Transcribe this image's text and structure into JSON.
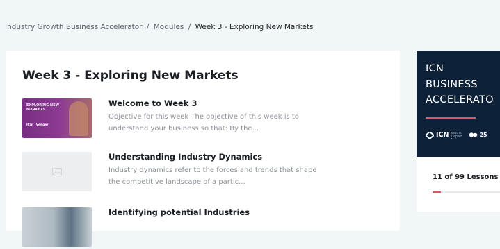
{
  "breadcrumb": {
    "items": [
      "Industry Growth Business Accelerator",
      "Modules"
    ],
    "separator": "/",
    "current": "Week 3 - Exploring New Markets"
  },
  "module": {
    "title": "Week 3 - Exploring New Markets",
    "lessons": [
      {
        "title": "Welcome to Week 3",
        "description": "Objective for this week The objective of this week is to understand your business so that: By the...",
        "thumbnail": {
          "type": "banner",
          "text": "EXPLORING NEW MARKETS",
          "logo_left": "ICN",
          "logo_right": "Veeger"
        }
      },
      {
        "title": "Understanding Industry Dynamics",
        "description": "Industry dynamics refer to the forces and trends that shape the competitive landscape of a partic...",
        "thumbnail": {
          "type": "placeholder",
          "icon": "image-placeholder-icon"
        }
      },
      {
        "title": "Identifying potential Industries",
        "description": "",
        "thumbnail": {
          "type": "photo"
        }
      }
    ]
  },
  "sidebar": {
    "title_lines": [
      "ICN",
      "BUSINESS",
      "ACCELERATO"
    ],
    "logo_text": "ICN",
    "logo_subtext": "Industry Capability Network",
    "partner_text": "25",
    "progress": {
      "label": "11 of 99 Lessons",
      "completed": 11,
      "total": 99
    }
  },
  "colors": {
    "background": "#f1f6f7",
    "navy": "#0d2239",
    "accent": "#e05562",
    "thumbnail_purple": "#8d3b93"
  }
}
